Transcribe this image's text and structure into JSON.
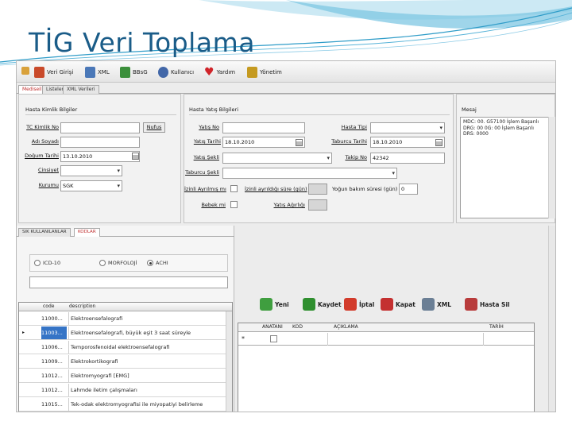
{
  "slide": {
    "title": "TİG Veri Toplama"
  },
  "toolbar": [
    {
      "label": "Veri Girişi",
      "icon": "data-entry-icon",
      "color": "#c94a2a"
    },
    {
      "label": "XML",
      "icon": "folder-icon",
      "color": "#4a78b8"
    },
    {
      "label": "BBsG",
      "icon": "chart-icon",
      "color": "#3b8f3b"
    },
    {
      "label": "Kullanıcı",
      "icon": "user-icon",
      "color": "#4267a8"
    },
    {
      "label": "Yardım",
      "icon": "heart-icon",
      "color": "#d0242a"
    },
    {
      "label": "Yönetim",
      "icon": "gear-icon",
      "color": "#c59a20"
    }
  ],
  "main_tabs": [
    "Mediseil",
    "Listeler",
    "XML Verileri"
  ],
  "patient": {
    "title": "Hasta Kimlik Bilgiler",
    "tc_label": "TC Kimlik No",
    "tc_value": "",
    "nufus_button": "Nufus",
    "name_label": "Adı Soyadı",
    "name_value": "",
    "birth_label": "Doğum Tarihi",
    "birth_value": "13.10.2010",
    "gender_label": "Cinsiyet",
    "gender_value": "",
    "institution_label": "Kurumu",
    "institution_value": "SGK"
  },
  "admission": {
    "title": "Hasta Yatış Bilgileri",
    "yatis_no_label": "Yatış No",
    "yatis_no_value": "",
    "yatis_tarihi_label": "Yatış Tarihi",
    "yatis_tarihi_value": "18.10.2010",
    "yatis_sekli_label": "Yatış Şekli",
    "yatis_sekli_value": "",
    "taburcu_sekli_label": "Taburcu Şekli",
    "taburcu_sekli_value": "",
    "izinli_label": "İzinli Ayrılmış mı",
    "izinli_gun_label": "İzinli ayrıldığı süre (gün)",
    "yogun_label": "Yoğun bakım süresi (gün)",
    "yogun_value": "0",
    "bebek_label": "Bebek mi",
    "yatis_agirlik_label": "Yatış Ağırlığı",
    "hasta_tipi_label": "Hasta Tipi",
    "hasta_tipi_value": "",
    "taburcu_tarihi_label": "Taburcu Tarihi",
    "taburcu_tarihi_value": "18.10.2010",
    "takip_no_label": "Takip No",
    "takip_no_value": "42342"
  },
  "message": {
    "title": "Mesaj",
    "text": "MDC: 00. G57100 İşlem Başarılı\nDRG: 00 0G: 00 İşlem Başarılı\nDRS: 0000"
  },
  "code_tabs": [
    "SIK KULLANILANLAR",
    "KODLAR"
  ],
  "code_types": [
    {
      "label": "ICD-10",
      "selected": false
    },
    {
      "label": "MORFOLOJİ",
      "selected": false
    },
    {
      "label": "ACHI",
      "selected": true
    }
  ],
  "code_search_value": "",
  "code_grid": {
    "headers": [
      "code",
      "description"
    ],
    "rows": [
      {
        "code": "11000...",
        "desc": "Elektroensefalografi",
        "selected": false
      },
      {
        "code": "11003...",
        "desc": "Elektroensefalografi, büyük eşit 3 saat süreyle",
        "selected": true
      },
      {
        "code": "11006...",
        "desc": "Temporosfenoidal elektroensefalografi",
        "selected": false
      },
      {
        "code": "11009...",
        "desc": "Elektrokortikografi",
        "selected": false
      },
      {
        "code": "11012...",
        "desc": "Elektromyografi [EMG]",
        "selected": false
      },
      {
        "code": "11012...",
        "desc": "Lahmde iletim çalışmaları",
        "selected": false
      },
      {
        "code": "11015...",
        "desc": "Tek-odak elektromyografisi ile miyopatiyi belirleme",
        "selected": false
      }
    ]
  },
  "actions": [
    {
      "label": "Yeni",
      "icon": "new-icon",
      "color": "#3f9e3f"
    },
    {
      "label": "Kaydet",
      "icon": "check-icon",
      "color": "#2f8f2f"
    },
    {
      "label": "İptal",
      "icon": "cancel-icon",
      "color": "#d23b2b"
    },
    {
      "label": "Kapat",
      "icon": "close-icon",
      "color": "#c43030"
    },
    {
      "label": "XML",
      "icon": "xml-icon",
      "color": "#6b7f95"
    },
    {
      "label": "Hasta Sil",
      "icon": "delete-patient-icon",
      "color": "#b83b3b"
    }
  ],
  "diag_grid": {
    "headers": [
      "ANATANI",
      "KOD",
      "AÇIKLAMA",
      "TARİH"
    ],
    "new_row_marker": "*"
  }
}
